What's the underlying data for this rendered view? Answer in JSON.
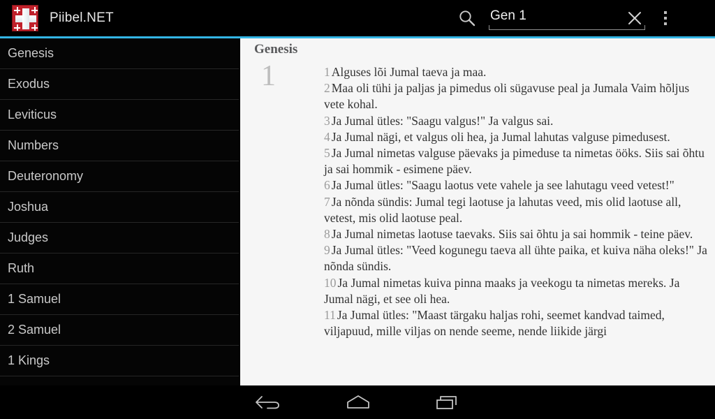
{
  "app": {
    "title": "Piibel.NET",
    "icon_name": "jerusalem-cross-icon",
    "accent_color": "#33b5e5",
    "icon_bg_color": "#c0202a"
  },
  "search": {
    "icon_name": "search-icon",
    "value": "Gen 1",
    "placeholder": "",
    "clear_icon_name": "close-icon",
    "overflow_icon_name": "overflow-menu-icon"
  },
  "sidebar": {
    "items": [
      {
        "label": "Genesis"
      },
      {
        "label": "Exodus"
      },
      {
        "label": "Leviticus"
      },
      {
        "label": "Numbers"
      },
      {
        "label": "Deuteronomy"
      },
      {
        "label": "Joshua"
      },
      {
        "label": "Judges"
      },
      {
        "label": "Ruth"
      },
      {
        "label": "1 Samuel"
      },
      {
        "label": "2 Samuel"
      },
      {
        "label": "1 Kings"
      }
    ]
  },
  "content": {
    "book": "Genesis",
    "chapter": "1",
    "verses": [
      {
        "n": "1",
        "text": "Alguses lõi Jumal taeva ja maa."
      },
      {
        "n": "2",
        "text": "Maa oli tühi ja paljas ja pimedus oli sügavuse peal ja Jumala Vaim hõljus vete kohal."
      },
      {
        "n": "3",
        "text": "Ja Jumal ütles: \"Saagu valgus!\" Ja valgus sai."
      },
      {
        "n": "4",
        "text": "Ja Jumal nägi, et valgus oli hea, ja Jumal lahutas valguse pimedusest."
      },
      {
        "n": "5",
        "text": "Ja Jumal nimetas valguse päevaks ja pimeduse ta nimetas ööks. Siis sai õhtu ja sai hommik - esimene päev."
      },
      {
        "n": "6",
        "text": "Ja Jumal ütles: \"Saagu laotus vete vahele ja see lahutagu veed vetest!\""
      },
      {
        "n": "7",
        "text": "Ja nõnda sündis: Jumal tegi laotuse ja lahutas veed, mis olid laotuse all, vetest, mis olid laotuse peal."
      },
      {
        "n": "8",
        "text": "Ja Jumal nimetas laotuse taevaks. Siis sai õhtu ja sai hommik - teine päev."
      },
      {
        "n": "9",
        "text": "Ja Jumal ütles: \"Veed kogunegu taeva all ühte paika, et kuiva näha oleks!\" Ja nõnda sündis."
      },
      {
        "n": "10",
        "text": "Ja Jumal nimetas kuiva pinna maaks ja veekogu ta nimetas mereks. Ja Jumal nägi, et see oli hea."
      },
      {
        "n": "11",
        "text": "Ja Jumal ütles: \"Maast tärgaku haljas rohi, seemet kandvad taimed, viljapuud, mille viljas on nende seeme, nende liikide järgi"
      }
    ]
  },
  "navbar": {
    "back_label": "Back",
    "home_label": "Home",
    "recent_label": "Recent apps"
  }
}
